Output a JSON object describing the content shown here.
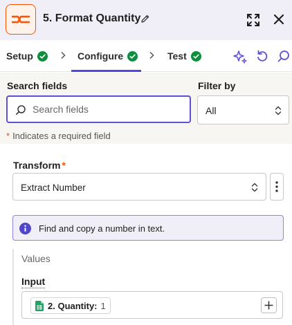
{
  "header": {
    "title": "5. Format Quantity",
    "logo_icon": "formatter-icon",
    "accent_color": "#ff4f00"
  },
  "tabs": [
    {
      "label": "Setup",
      "status": "complete"
    },
    {
      "label": "Configure",
      "status": "complete",
      "active": true
    },
    {
      "label": "Test",
      "status": "complete"
    }
  ],
  "toolbar_icons": [
    "sparkle-icon",
    "undo-icon",
    "search-icon"
  ],
  "search": {
    "label": "Search fields",
    "placeholder": "Search fields",
    "value": ""
  },
  "filter": {
    "label": "Filter by",
    "value": "All"
  },
  "required_note": "Indicates a required field",
  "required_marker": "*",
  "transform": {
    "label": "Transform",
    "value": "Extract Number"
  },
  "info": {
    "text": "Find and copy a number in text."
  },
  "values": {
    "title": "Values",
    "input_label": "Input",
    "input_pill": {
      "label": "2. Quantity:",
      "value": "1",
      "icon": "google-sheets-icon"
    }
  },
  "colors": {
    "primary": "#5b4fd8",
    "success": "#0a8f3c",
    "required": "#e8590c"
  }
}
